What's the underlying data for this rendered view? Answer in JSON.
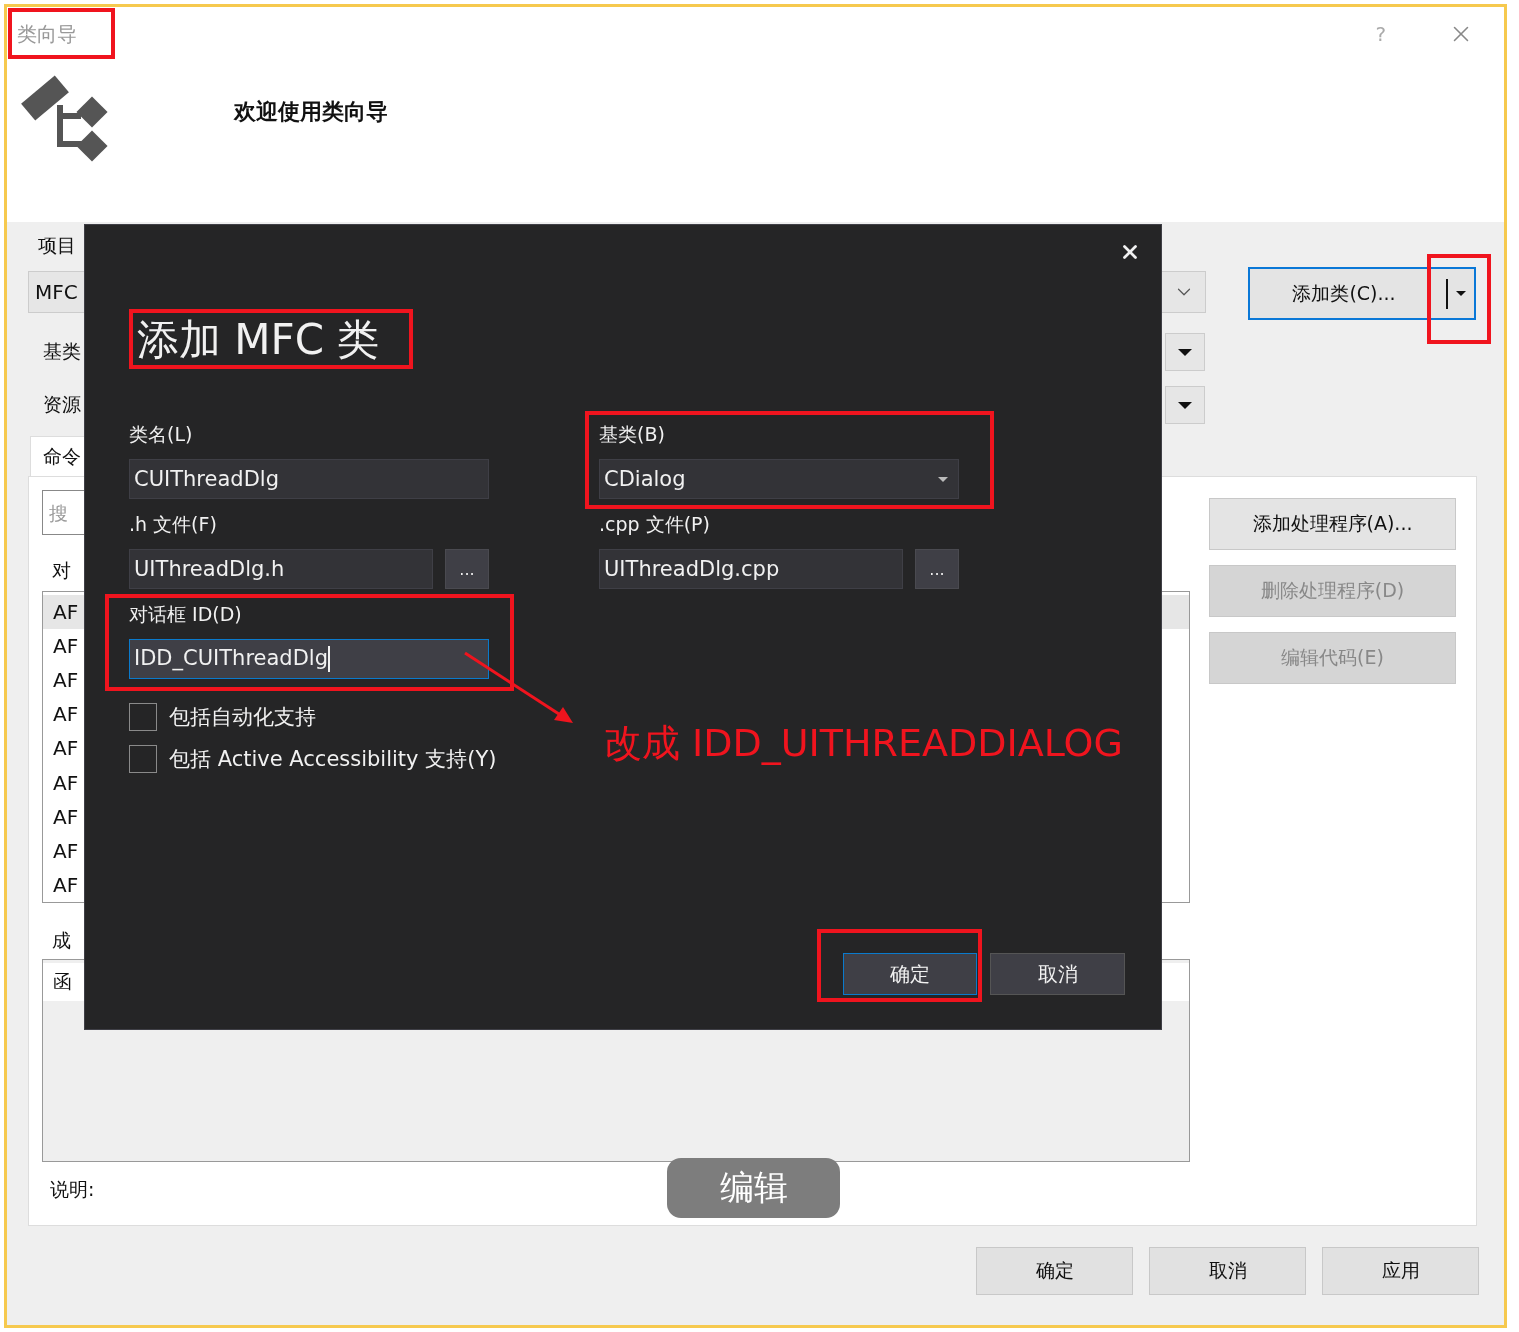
{
  "window": {
    "title": "类向导",
    "help": "?"
  },
  "header": {
    "welcome": "欢迎使用类向导"
  },
  "project": {
    "label": "项目",
    "value": "MFC"
  },
  "base_class": {
    "label": "基类"
  },
  "resource": {
    "label": "资源"
  },
  "add_class_button": {
    "label": "添加类(C)..."
  },
  "tabs": [
    {
      "label": "命令",
      "selected": true
    }
  ],
  "search": {
    "placeholder": "搜"
  },
  "objects": {
    "label": "对",
    "items": [
      {
        "text": "AF",
        "selected": true
      },
      {
        "text": "AF",
        "selected": false
      },
      {
        "text": "AF",
        "selected": false
      },
      {
        "text": "AF",
        "selected": false
      },
      {
        "text": "AF",
        "selected": false
      },
      {
        "text": "AF",
        "selected": false
      },
      {
        "text": "AF",
        "selected": false
      },
      {
        "text": "AF",
        "selected": false
      },
      {
        "text": "AF",
        "selected": false
      }
    ]
  },
  "handler_buttons": [
    {
      "label": "添加处理程序(A)...",
      "disabled": false
    },
    {
      "label": "删除处理程序(D)",
      "disabled": true
    },
    {
      "label": "编辑代码(E)",
      "disabled": true
    }
  ],
  "members": {
    "label": "成",
    "columns": [
      "函"
    ]
  },
  "description": {
    "label": "说明:"
  },
  "footer_buttons": [
    "确定",
    "取消",
    "应用"
  ],
  "add_mfc_class_dialog": {
    "title": "添加 MFC 类",
    "fields": [
      {
        "kind": "text",
        "label": "类名(L)",
        "value": "CUIThreadDlg",
        "focused": false
      },
      {
        "kind": "dropdown",
        "label": "基类(B)",
        "value": "CDialog",
        "focused": false
      },
      {
        "kind": "file",
        "label": ".h 文件(F)",
        "value": "UIThreadDlg.h",
        "browse": "...",
        "focused": false
      },
      {
        "kind": "file",
        "label": ".cpp 文件(P)",
        "value": "UIThreadDlg.cpp",
        "browse": "...",
        "focused": false
      },
      {
        "kind": "text",
        "label": "对话框 ID(D)",
        "value": "IDD_CUIThreadDlg",
        "focused": true
      }
    ],
    "checkboxes": [
      {
        "label": "包括自动化支持",
        "checked": false
      },
      {
        "label": "包括 Active Accessibility 支持(Y)",
        "checked": false
      }
    ],
    "buttons": [
      {
        "label": "确定",
        "default": true
      },
      {
        "label": "取消",
        "default": false
      }
    ]
  },
  "annotation": {
    "note": "改成 IDD_UITHREADDIALOG"
  },
  "overlay_button": {
    "label": "编辑"
  }
}
